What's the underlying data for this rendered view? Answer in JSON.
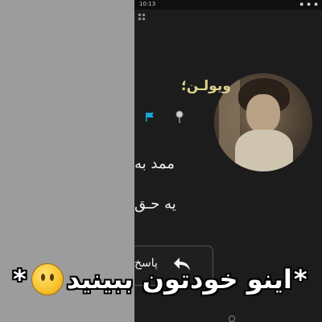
{
  "statusbar": {
    "time": "10:13",
    "icons": "▪ ▪ ▪"
  },
  "profile": {
    "name": "ویولـن؛"
  },
  "messages": [
    {
      "text": "ممد به"
    },
    {
      "text": "یه حـق"
    }
  ],
  "reply": {
    "label": "پاسخ"
  },
  "caption": {
    "star_left": "*",
    "text": "اینو خودتون ببینید",
    "star_right": "*"
  },
  "colors": {
    "name": "#d9d28a",
    "flag": "#19a6d6",
    "caption": "#ffffff",
    "background": "#1c1c1c"
  },
  "icons": [
    "flag-icon",
    "pin-icon",
    "reply-arrow-icon",
    "grid-icon",
    "emoji-face-icon"
  ]
}
